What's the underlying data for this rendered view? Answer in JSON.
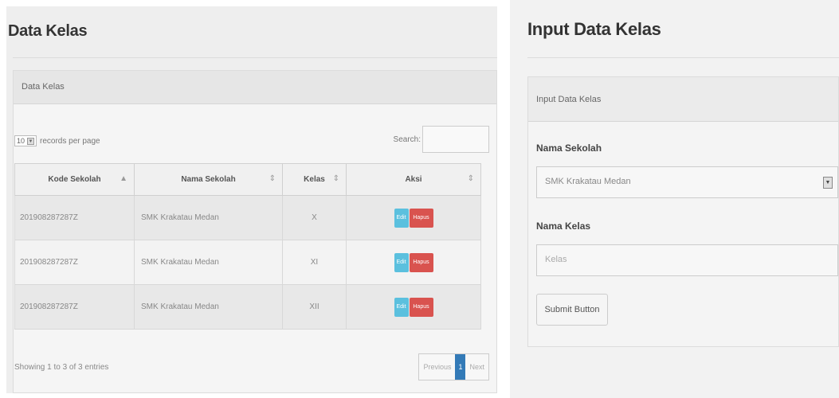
{
  "list": {
    "page_title": "Data Kelas",
    "panel_heading": "Data Kelas",
    "length_value": "10",
    "length_label": "records per page",
    "search_label": "Search:",
    "columns": [
      "Kode Sekolah",
      "Nama Sekolah",
      "Kelas",
      "Aksi"
    ],
    "rows": [
      {
        "kode": "201908287287Z",
        "nama": "SMK Krakatau Medan",
        "kelas": "X",
        "edit": "Edit",
        "hapus": "Hapus"
      },
      {
        "kode": "201908287287Z",
        "nama": "SMK Krakatau Medan",
        "kelas": "XI",
        "edit": "Edit",
        "hapus": "Hapus"
      },
      {
        "kode": "201908287287Z",
        "nama": "SMK Krakatau Medan",
        "kelas": "XII",
        "edit": "Edit",
        "hapus": "Hapus"
      }
    ],
    "info": "Showing 1 to 3 of 3 entries",
    "pager": {
      "prev": "Previous",
      "current": "1",
      "next": "Next"
    }
  },
  "form": {
    "page_title": "Input Data Kelas",
    "panel_heading": "Input Data Kelas",
    "school_label": "Nama Sekolah",
    "school_value": "SMK Krakatau Medan",
    "class_label": "Nama Kelas",
    "class_placeholder": "Kelas",
    "submit_label": "Submit Button"
  },
  "colors": {
    "edit": "#5bc0de",
    "hapus": "#d9534f",
    "pager_active": "#337ab7"
  }
}
